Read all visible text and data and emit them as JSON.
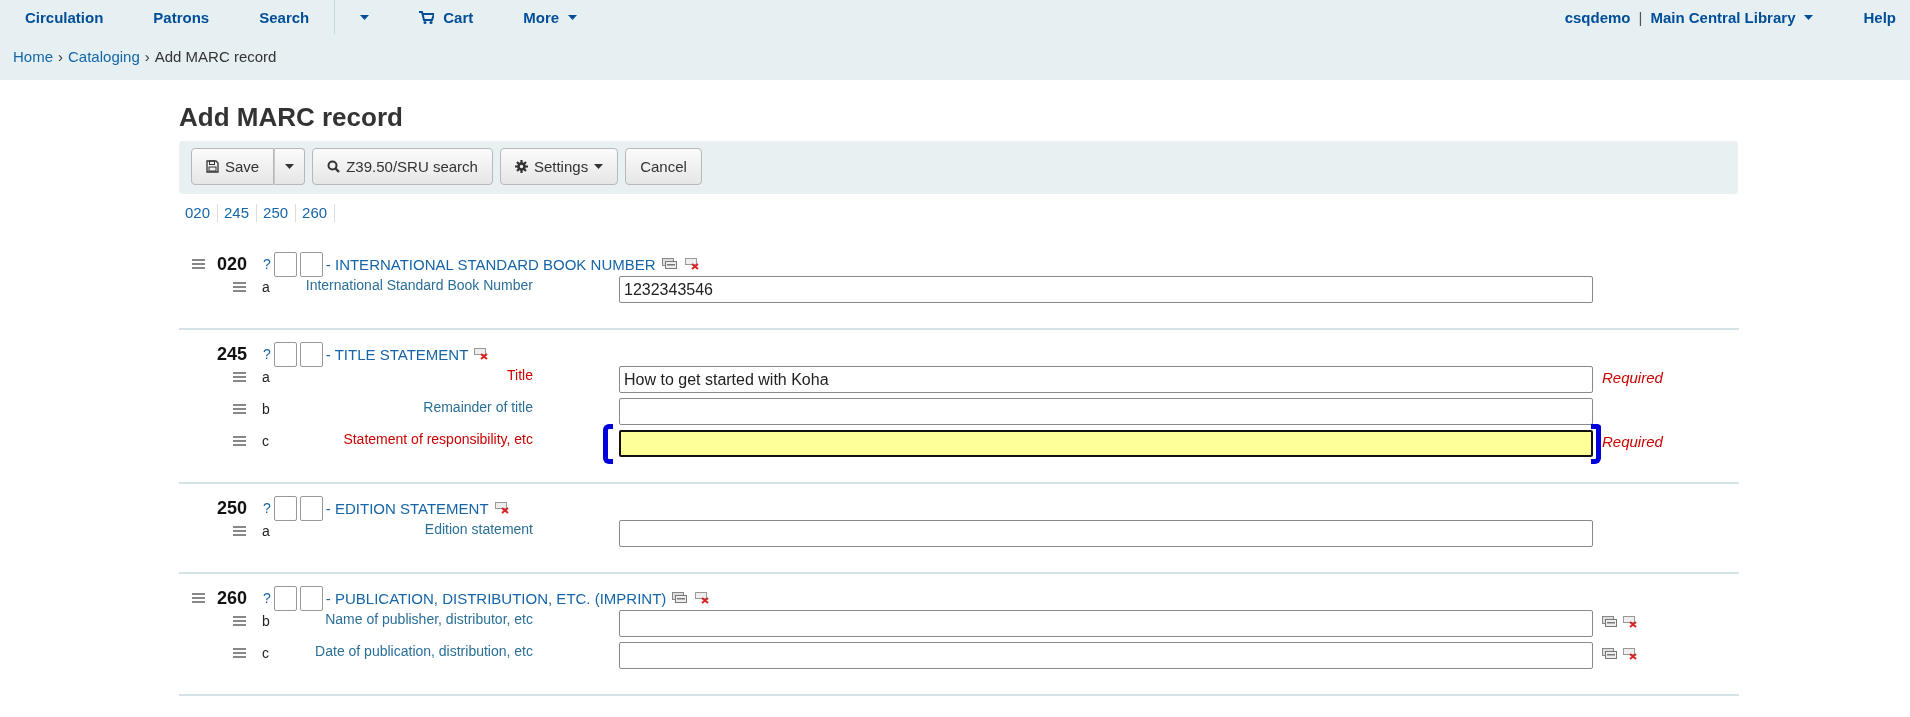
{
  "nav": {
    "left": [
      {
        "label": "Circulation",
        "kind": "link"
      },
      {
        "label": "Patrons",
        "kind": "link"
      },
      {
        "label": "Search",
        "kind": "link"
      },
      {
        "kind": "caret"
      },
      {
        "label": "Cart",
        "kind": "cart"
      },
      {
        "label": "More",
        "kind": "menu"
      }
    ],
    "user": "csqdemo",
    "separator": "|",
    "library": "Main Central Library",
    "help": "Help"
  },
  "breadcrumb": [
    {
      "label": "Home",
      "link": true
    },
    {
      "label": "Cataloging",
      "link": true
    },
    {
      "label": "Add MARC record",
      "link": false
    }
  ],
  "breadcrumb_separator": "›",
  "title": "Add MARC record",
  "toolbar": [
    {
      "label": "Save",
      "kind": "split"
    },
    {
      "label": "Z39.50/SRU search",
      "kind": "search"
    },
    {
      "label": "Settings",
      "kind": "menu"
    },
    {
      "label": "Cancel",
      "kind": "plain"
    }
  ],
  "tag_links": [
    "020",
    "245",
    "250",
    "260"
  ],
  "fields": [
    {
      "tag": "020",
      "help": "?",
      "title": "- INTERNATIONAL STANDARD BOOK NUMBER",
      "repeatable": true,
      "subfields": [
        {
          "code": "a",
          "label": "International Standard Book Number",
          "required": false,
          "value": "1232343546",
          "focused": false,
          "repeatable": false,
          "annotated": false
        }
      ]
    },
    {
      "tag": "245",
      "help": "?",
      "title": "- TITLE STATEMENT",
      "repeatable": false,
      "subfields": [
        {
          "code": "a",
          "label": "Title",
          "required": true,
          "value": "How to get started with Koha",
          "focused": false,
          "repeatable": false,
          "annotated": false,
          "note": "Required"
        },
        {
          "code": "b",
          "label": "Remainder of title",
          "required": false,
          "focused": false,
          "repeatable": false,
          "annotated": false
        },
        {
          "code": "c",
          "label": "Statement of responsibility, etc",
          "required": true,
          "focused": true,
          "repeatable": false,
          "annotated": true,
          "note": "Required"
        }
      ]
    },
    {
      "tag": "250",
      "help": "?",
      "title": "- EDITION STATEMENT",
      "repeatable": false,
      "subfields": [
        {
          "code": "a",
          "label": "Edition statement",
          "required": false,
          "focused": false,
          "repeatable": false,
          "annotated": false
        }
      ]
    },
    {
      "tag": "260",
      "help": "?",
      "title": "- PUBLICATION, DISTRIBUTION, ETC. (IMPRINT)",
      "repeatable": true,
      "subfields": [
        {
          "code": "b",
          "label": "Name of publisher, distributor, etc",
          "required": false,
          "focused": false,
          "repeatable": true,
          "annotated": false
        },
        {
          "code": "c",
          "label": "Date of publication, distribution, etc",
          "required": false,
          "focused": false,
          "repeatable": true,
          "annotated": false
        }
      ]
    }
  ]
}
